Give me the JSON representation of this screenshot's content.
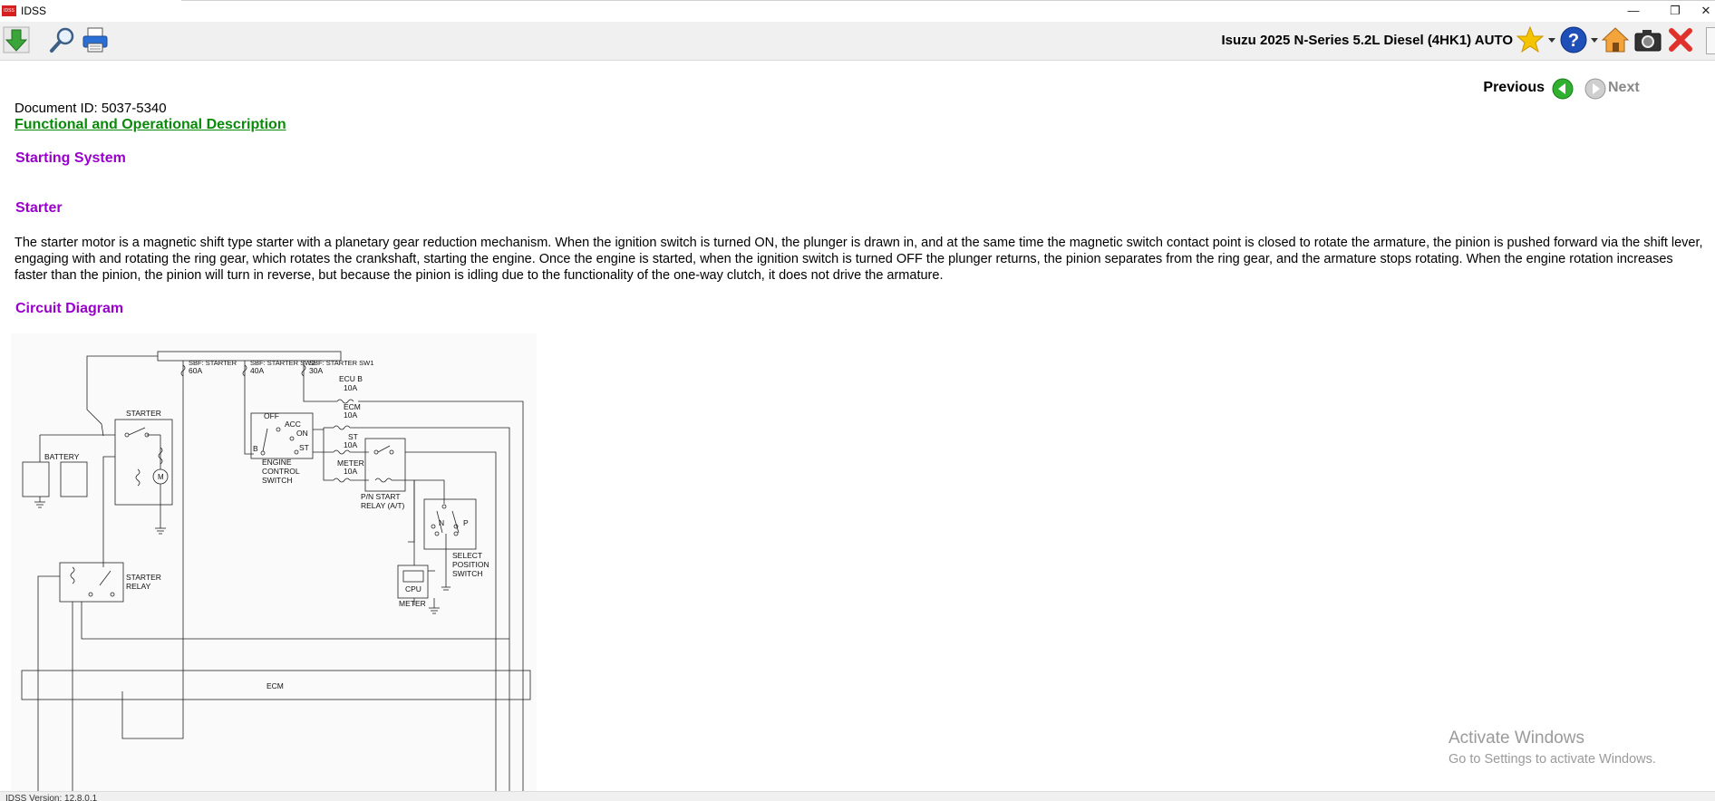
{
  "window": {
    "app_icon_text": "IDSS",
    "title": "IDSS",
    "minimize": "—",
    "restore": "❐",
    "close": "✕"
  },
  "toolbar": {
    "vehicle": "Isuzu 2025 N-Series 5.2L Diesel (4HK1) AUTO",
    "icons": [
      "download-icon",
      "search-icon",
      "print-icon",
      "favorite-star-icon",
      "help-icon",
      "home-icon",
      "camera-icon",
      "close-red-icon"
    ]
  },
  "navigation": {
    "previous": "Previous",
    "next": "Next"
  },
  "document": {
    "id": "Document ID: 5037-5340",
    "type": "Functional and Operational Description",
    "section_title": "Starting System",
    "subsection": "Starter",
    "description": "The starter motor is a magnetic shift type starter with a planetary gear reduction mechanism. When the ignition switch is turned ON, the plunger is drawn in, and at the same time the magnetic switch contact point is closed to rotate the armature, the pinion is pushed forward via the shift lever, engaging with and rotating the ring gear, which rotates the crankshaft, starting the engine. Once the engine is started, when the ignition switch is turned OFF the plunger returns, the pinion separates from the ring gear, and the armature stops rotating. When the engine rotation increases faster than the pinion, the pinion will turn in reverse, but because the pinion is idling due to the functionality of the one-way clutch, it does not drive the armature.",
    "diagram_heading": "Circuit Diagram"
  },
  "diagram": {
    "fuse_starter": "SBF: STARTER",
    "fuse_starter_amp": "60A",
    "fuse_sw2": "SBF: STARTER SW2",
    "fuse_sw2_amp": "40A",
    "fuse_sw1": "SBF: STARTER SW1",
    "fuse_sw1_amp": "30A",
    "ecu_b": "ECU B",
    "ecu_b_amp": "10A",
    "ecm_fuse": "ECM",
    "ecm_fuse_amp": "10A",
    "st_fuse": "ST",
    "st_fuse_amp": "10A",
    "meter_fuse": "METER",
    "meter_fuse_amp": "10A",
    "starter": "STARTER",
    "battery": "BATTERY",
    "motor": "M",
    "ign_off": "OFF",
    "ign_acc": "ACC",
    "ign_on": "ON",
    "ign_st": "ST",
    "ign_b": "B",
    "engine_switch_1": "ENGINE",
    "engine_switch_2": "CONTROL",
    "engine_switch_3": "SWITCH",
    "pn_relay_1": "P/N START",
    "pn_relay_2": "RELAY (A/T)",
    "select_n": "N",
    "select_p": "P",
    "select_1": "SELECT",
    "select_2": "POSITION",
    "select_3": "SWITCH",
    "starter_relay_1": "STARTER",
    "starter_relay_2": "RELAY",
    "cpu": "CPU",
    "meter": "METER",
    "ecm": "ECM"
  },
  "watermark": {
    "title": "Activate Windows",
    "subtitle": "Go to Settings to activate Windows."
  },
  "status": {
    "version": "IDSS Version: 12.8.0.1"
  }
}
